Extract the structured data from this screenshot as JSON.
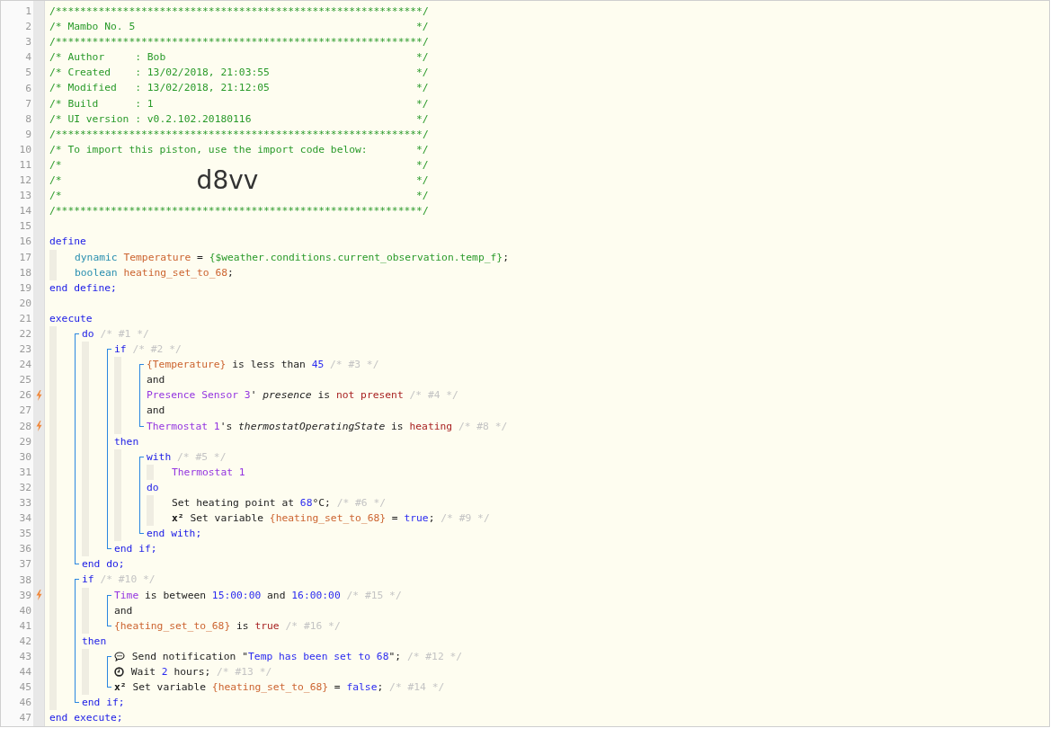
{
  "editor": {
    "lines": [
      {
        "kind": "line",
        "number": "1",
        "trigger": false,
        "tokens": [
          {
            "kind": "comment",
            "text": "/************************************************************/"
          }
        ]
      },
      {
        "kind": "line",
        "number": "2",
        "trigger": false,
        "tokens": [
          {
            "kind": "comment_padded",
            "text": "/* Mambo No. 5"
          },
          {
            "kind": "comment",
            "text": "*/"
          }
        ]
      },
      {
        "kind": "line",
        "number": "3",
        "trigger": false,
        "tokens": [
          {
            "kind": "comment",
            "text": "/************************************************************/"
          }
        ]
      },
      {
        "kind": "line",
        "number": "4",
        "trigger": false,
        "tokens": [
          {
            "kind": "comment_padded",
            "text": "/* Author     : Bob"
          },
          {
            "kind": "comment",
            "text": "*/"
          }
        ]
      },
      {
        "kind": "line",
        "number": "5",
        "trigger": false,
        "tokens": [
          {
            "kind": "comment_padded",
            "text": "/* Created    : 13/02/2018, 21:03:55"
          },
          {
            "kind": "comment",
            "text": "*/"
          }
        ]
      },
      {
        "kind": "line",
        "number": "6",
        "trigger": false,
        "tokens": [
          {
            "kind": "comment_padded",
            "text": "/* Modified   : 13/02/2018, 21:12:05"
          },
          {
            "kind": "comment",
            "text": "*/"
          }
        ]
      },
      {
        "kind": "line",
        "number": "7",
        "trigger": false,
        "tokens": [
          {
            "kind": "comment_padded",
            "text": "/* Build      : 1"
          },
          {
            "kind": "comment",
            "text": "*/"
          }
        ]
      },
      {
        "kind": "line",
        "number": "8",
        "trigger": false,
        "tokens": [
          {
            "kind": "comment_padded",
            "text": "/* UI version : v0.2.102.20180116"
          },
          {
            "kind": "comment",
            "text": "*/"
          }
        ]
      },
      {
        "kind": "line",
        "number": "9",
        "trigger": false,
        "tokens": [
          {
            "kind": "comment",
            "text": "/************************************************************/"
          }
        ]
      },
      {
        "kind": "line",
        "number": "10",
        "trigger": false,
        "tokens": [
          {
            "kind": "comment_padded",
            "text": "/* To import this piston, use the import code below:"
          },
          {
            "kind": "comment",
            "text": "*/"
          }
        ]
      },
      {
        "kind": "line",
        "number": "11",
        "trigger": false,
        "tokens": [
          {
            "kind": "comment_padded",
            "text": "/*"
          },
          {
            "kind": "comment",
            "text": "*/"
          }
        ]
      },
      {
        "kind": "line",
        "number": "12",
        "trigger": false,
        "tokens": [
          {
            "kind": "comment",
            "text": "/*"
          },
          {
            "kind": "import_code",
            "text": "d8vv"
          },
          {
            "kind": "comment_end",
            "text": "*/"
          }
        ]
      },
      {
        "kind": "line",
        "number": "13",
        "trigger": false,
        "tokens": [
          {
            "kind": "comment_padded",
            "text": "/*"
          },
          {
            "kind": "comment",
            "text": "*/"
          }
        ]
      },
      {
        "kind": "line",
        "number": "14",
        "trigger": false,
        "tokens": [
          {
            "kind": "comment",
            "text": "/************************************************************/"
          }
        ]
      },
      {
        "kind": "line",
        "number": "15",
        "trigger": false
      },
      {
        "kind": "line",
        "number": "16",
        "trigger": false,
        "tokens": [
          {
            "kind": "keyword",
            "text": "define"
          }
        ],
        "children": [
          {
            "kind": "line",
            "number": "17",
            "trigger": false,
            "tokens": [
              {
                "kind": "type",
                "text": "dynamic "
              },
              {
                "kind": "variable",
                "text": "Temperature"
              },
              {
                "kind": "plain",
                "text": " = "
              },
              {
                "kind": "expression",
                "text": "{$weather.conditions.current_observation.temp_f}"
              },
              {
                "kind": "plain",
                "text": ";"
              }
            ]
          },
          {
            "kind": "line",
            "number": "18",
            "trigger": false,
            "tokens": [
              {
                "kind": "type",
                "text": "boolean "
              },
              {
                "kind": "variable",
                "text": "heating_set_to_68"
              },
              {
                "kind": "plain",
                "text": ";"
              }
            ]
          }
        ]
      },
      {
        "kind": "line",
        "number": "19",
        "trigger": false,
        "tokens": [
          {
            "kind": "keyword",
            "text": "end define;"
          }
        ]
      },
      {
        "kind": "line",
        "number": "20",
        "trigger": false
      },
      {
        "kind": "line",
        "number": "21",
        "trigger": false,
        "tokens": [
          {
            "kind": "keyword",
            "text": "execute"
          }
        ],
        "children": [
          {
            "kind": "bracket",
            "children": [
              {
                "kind": "line",
                "number": "22",
                "trigger": false,
                "tokens": [
                  {
                    "kind": "keyword",
                    "text": "do"
                  },
                  {
                    "kind": "note",
                    "text": " /* #1 */"
                  }
                ],
                "children": [
                  {
                    "kind": "bracket",
                    "children": [
                      {
                        "kind": "line",
                        "number": "23",
                        "trigger": false,
                        "tokens": [
                          {
                            "kind": "keyword",
                            "text": "if"
                          },
                          {
                            "kind": "note",
                            "text": " /* #2 */"
                          }
                        ],
                        "children": [
                          {
                            "kind": "bracket",
                            "children": [
                              {
                                "kind": "line",
                                "number": "24",
                                "trigger": false,
                                "tokens": [
                                  {
                                    "kind": "variable",
                                    "text": "{Temperature}"
                                  },
                                  {
                                    "kind": "plain",
                                    "text": " is less than "
                                  },
                                  {
                                    "kind": "number",
                                    "text": "45"
                                  },
                                  {
                                    "kind": "note",
                                    "text": " /* #3 */"
                                  }
                                ]
                              },
                              {
                                "kind": "line",
                                "number": "25",
                                "trigger": false,
                                "tokens": [
                                  {
                                    "kind": "plain",
                                    "text": "and"
                                  }
                                ]
                              },
                              {
                                "kind": "line",
                                "number": "26",
                                "trigger": true,
                                "tokens": [
                                  {
                                    "kind": "device",
                                    "text": "Presence Sensor 3"
                                  },
                                  {
                                    "kind": "plain",
                                    "text": "' "
                                  },
                                  {
                                    "kind": "attribute",
                                    "text": "presence"
                                  },
                                  {
                                    "kind": "plain",
                                    "text": " is "
                                  },
                                  {
                                    "kind": "value",
                                    "text": "not present"
                                  },
                                  {
                                    "kind": "note",
                                    "text": " /* #4 */"
                                  }
                                ]
                              },
                              {
                                "kind": "line",
                                "number": "27",
                                "trigger": false,
                                "tokens": [
                                  {
                                    "kind": "plain",
                                    "text": "and"
                                  }
                                ]
                              },
                              {
                                "kind": "line",
                                "number": "28",
                                "trigger": true,
                                "tokens": [
                                  {
                                    "kind": "device",
                                    "text": "Thermostat 1"
                                  },
                                  {
                                    "kind": "plain",
                                    "text": "'s "
                                  },
                                  {
                                    "kind": "attribute",
                                    "text": "thermostatOperatingState"
                                  },
                                  {
                                    "kind": "plain",
                                    "text": " is "
                                  },
                                  {
                                    "kind": "value",
                                    "text": "heating"
                                  },
                                  {
                                    "kind": "note",
                                    "text": " /* #8 */"
                                  }
                                ]
                              }
                            ]
                          }
                        ]
                      },
                      {
                        "kind": "line",
                        "number": "29",
                        "trigger": false,
                        "tokens": [
                          {
                            "kind": "keyword",
                            "text": "then"
                          }
                        ],
                        "children": [
                          {
                            "kind": "bracket",
                            "children": [
                              {
                                "kind": "line",
                                "number": "30",
                                "trigger": false,
                                "tokens": [
                                  {
                                    "kind": "keyword",
                                    "text": "with"
                                  },
                                  {
                                    "kind": "note",
                                    "text": " /* #5 */"
                                  }
                                ],
                                "children": [
                                  {
                                    "kind": "line",
                                    "number": "31",
                                    "trigger": false,
                                    "tokens": [
                                      {
                                        "kind": "device",
                                        "text": "Thermostat 1"
                                      }
                                    ]
                                  }
                                ]
                              },
                              {
                                "kind": "line",
                                "number": "32",
                                "trigger": false,
                                "tokens": [
                                  {
                                    "kind": "keyword",
                                    "text": "do"
                                  }
                                ],
                                "children": [
                                  {
                                    "kind": "line",
                                    "number": "33",
                                    "trigger": false,
                                    "tokens": [
                                      {
                                        "kind": "plain",
                                        "text": "Set heating point at "
                                      },
                                      {
                                        "kind": "number",
                                        "text": "68"
                                      },
                                      {
                                        "kind": "plain",
                                        "text": "°C; "
                                      },
                                      {
                                        "kind": "note",
                                        "text": "/* #6 */"
                                      }
                                    ]
                                  },
                                  {
                                    "kind": "line",
                                    "number": "34",
                                    "trigger": false,
                                    "tokens": [
                                      {
                                        "kind": "symbol",
                                        "text": "x²"
                                      },
                                      {
                                        "kind": "plain",
                                        "text": " Set variable "
                                      },
                                      {
                                        "kind": "variable",
                                        "text": "{heating_set_to_68}"
                                      },
                                      {
                                        "kind": "plain",
                                        "text": " = "
                                      },
                                      {
                                        "kind": "number",
                                        "text": "true"
                                      },
                                      {
                                        "kind": "plain",
                                        "text": "; "
                                      },
                                      {
                                        "kind": "note",
                                        "text": "/* #9 */"
                                      }
                                    ]
                                  }
                                ]
                              },
                              {
                                "kind": "line",
                                "number": "35",
                                "trigger": false,
                                "tokens": [
                                  {
                                    "kind": "keyword",
                                    "text": "end with;"
                                  }
                                ]
                              }
                            ]
                          }
                        ]
                      },
                      {
                        "kind": "line",
                        "number": "36",
                        "trigger": false,
                        "tokens": [
                          {
                            "kind": "keyword",
                            "text": "end if;"
                          }
                        ]
                      }
                    ]
                  }
                ]
              },
              {
                "kind": "line",
                "number": "37",
                "trigger": false,
                "tokens": [
                  {
                    "kind": "keyword",
                    "text": "end do;"
                  }
                ]
              }
            ]
          },
          {
            "kind": "bracket",
            "children": [
              {
                "kind": "line",
                "number": "38",
                "trigger": false,
                "tokens": [
                  {
                    "kind": "keyword",
                    "text": "if"
                  },
                  {
                    "kind": "note",
                    "text": " /* #10 */"
                  }
                ],
                "children": [
                  {
                    "kind": "bracket",
                    "children": [
                      {
                        "kind": "line",
                        "number": "39",
                        "trigger": true,
                        "tokens": [
                          {
                            "kind": "device",
                            "text": "Time"
                          },
                          {
                            "kind": "plain",
                            "text": " is between "
                          },
                          {
                            "kind": "number",
                            "text": "15:00:00"
                          },
                          {
                            "kind": "plain",
                            "text": " and "
                          },
                          {
                            "kind": "number",
                            "text": "16:00:00"
                          },
                          {
                            "kind": "note",
                            "text": " /* #15 */"
                          }
                        ]
                      },
                      {
                        "kind": "line",
                        "number": "40",
                        "trigger": false,
                        "tokens": [
                          {
                            "kind": "plain",
                            "text": "and"
                          }
                        ]
                      },
                      {
                        "kind": "line",
                        "number": "41",
                        "trigger": false,
                        "tokens": [
                          {
                            "kind": "variable",
                            "text": "{heating_set_to_68}"
                          },
                          {
                            "kind": "plain",
                            "text": " is "
                          },
                          {
                            "kind": "value",
                            "text": "true"
                          },
                          {
                            "kind": "note",
                            "text": " /* #16 */"
                          }
                        ]
                      }
                    ]
                  }
                ]
              },
              {
                "kind": "line",
                "number": "42",
                "trigger": false,
                "tokens": [
                  {
                    "kind": "keyword",
                    "text": "then"
                  }
                ],
                "children": [
                  {
                    "kind": "bracket",
                    "children": [
                      {
                        "kind": "line",
                        "number": "43",
                        "trigger": false,
                        "tokens": [
                          {
                            "kind": "speech_icon"
                          },
                          {
                            "kind": "plain",
                            "text": " Send notification \""
                          },
                          {
                            "kind": "string",
                            "text": "Temp has been set to 68"
                          },
                          {
                            "kind": "plain",
                            "text": "\"; "
                          },
                          {
                            "kind": "note",
                            "text": "/* #12 */"
                          }
                        ]
                      },
                      {
                        "kind": "line",
                        "number": "44",
                        "trigger": false,
                        "tokens": [
                          {
                            "kind": "clock_icon"
                          },
                          {
                            "kind": "plain",
                            "text": " Wait "
                          },
                          {
                            "kind": "number",
                            "text": "2"
                          },
                          {
                            "kind": "plain",
                            "text": " hours; "
                          },
                          {
                            "kind": "note",
                            "text": "/* #13 */"
                          }
                        ]
                      },
                      {
                        "kind": "line",
                        "number": "45",
                        "trigger": false,
                        "tokens": [
                          {
                            "kind": "symbol",
                            "text": "x²"
                          },
                          {
                            "kind": "plain",
                            "text": " Set variable "
                          },
                          {
                            "kind": "variable",
                            "text": "{heating_set_to_68}"
                          },
                          {
                            "kind": "plain",
                            "text": " = "
                          },
                          {
                            "kind": "number",
                            "text": "false"
                          },
                          {
                            "kind": "plain",
                            "text": "; "
                          },
                          {
                            "kind": "note",
                            "text": "/* #14 */"
                          }
                        ]
                      }
                    ]
                  }
                ]
              },
              {
                "kind": "line",
                "number": "46",
                "trigger": false,
                "tokens": [
                  {
                    "kind": "keyword",
                    "text": "end if;"
                  }
                ]
              }
            ]
          }
        ]
      },
      {
        "kind": "line",
        "number": "47",
        "trigger": false,
        "tokens": [
          {
            "kind": "keyword",
            "text": "end execute;"
          }
        ]
      }
    ]
  }
}
